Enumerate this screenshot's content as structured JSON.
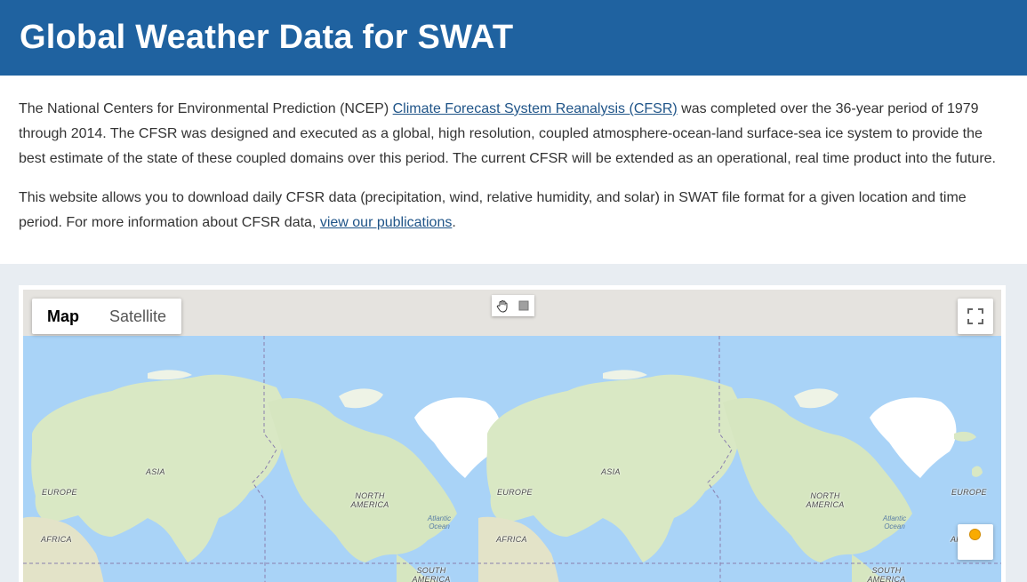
{
  "header": {
    "title": "Global Weather Data for SWAT"
  },
  "intro": {
    "p1_before": "The National Centers for Environmental Prediction (NCEP) ",
    "p1_link": "Climate Forecast System Reanalysis (CFSR)",
    "p1_after": " was completed over the 36-year period of 1979 through 2014. The CFSR was designed and executed as a global, high resolution, coupled atmosphere-ocean-land surface-sea ice system to provide the best estimate of the state of these coupled domains over this period. The current CFSR will be extended as an operational, real time product into the future.",
    "p2_before": "This website allows you to download daily CFSR data (precipitation, wind, relative humidity, and solar) in SWAT file format for a given location and time period. For more information about CFSR data, ",
    "p2_link": "view our publications",
    "p2_after": "."
  },
  "map": {
    "type_buttons": [
      "Map",
      "Satellite"
    ],
    "active_type": "Map",
    "icons": {
      "pan": "hand-pan-icon",
      "rect": "rectangle-select-icon",
      "fullscreen": "fullscreen-icon",
      "pegman": "pegman-icon"
    },
    "labels": {
      "europe": "EUROPE",
      "asia": "ASIA",
      "africa": "AFRICA",
      "north_america": "NORTH AMERICA",
      "south_america": "SOUTH AMERICA",
      "atlantic_ocean": "Atlantic Ocean"
    },
    "colors": {
      "water": "#a9d3f7",
      "land": "#d9e8c4",
      "ice": "#ffffff",
      "header": "#1f62a0"
    }
  }
}
